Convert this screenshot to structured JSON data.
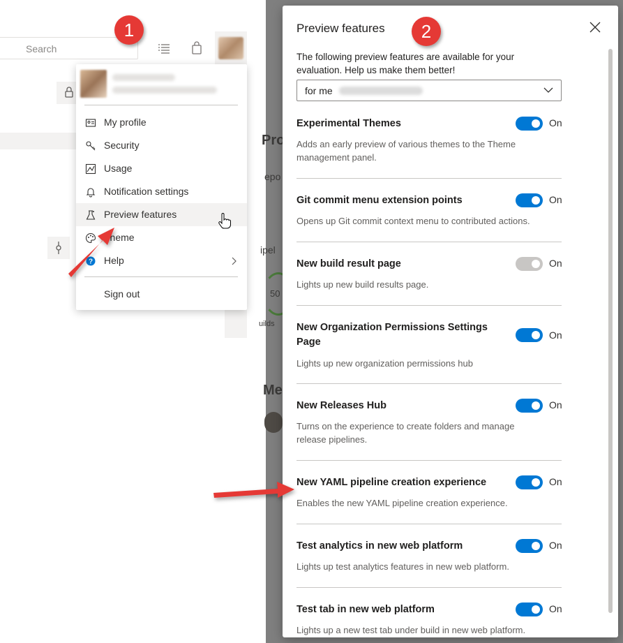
{
  "header": {
    "search_placeholder": "Search",
    "icons": [
      "search-icon",
      "list-icon",
      "shopping-bag-icon"
    ]
  },
  "profile_menu": {
    "items": [
      {
        "label": "My profile",
        "icon": "contact-card-icon"
      },
      {
        "label": "Security",
        "icon": "key-icon"
      },
      {
        "label": "Usage",
        "icon": "chart-icon"
      },
      {
        "label": "Notification settings",
        "icon": "bell-icon"
      },
      {
        "label": "Preview features",
        "icon": "flask-icon"
      },
      {
        "label": "Theme",
        "icon": "palette-icon"
      },
      {
        "label": "Help",
        "icon": "help-icon"
      }
    ],
    "sign_out": "Sign out"
  },
  "background": {
    "ghost_texts": [
      "Proj",
      "epo",
      "ipel",
      "50",
      "uilds",
      "Men"
    ]
  },
  "panel": {
    "title": "Preview features",
    "description": "The following preview features are available for your evaluation. Help us make them better!",
    "select_prefix": "for me",
    "features": [
      {
        "title": "Experimental Themes",
        "description": "Adds an early preview of various themes to the Theme management panel.",
        "state": "On",
        "enabled": true
      },
      {
        "title": "Git commit menu extension points",
        "description": "Opens up Git commit context menu to contributed actions.",
        "state": "On",
        "enabled": true
      },
      {
        "title": "New build result page",
        "description": "Lights up new build results page.",
        "state": "On",
        "enabled": false
      },
      {
        "title": "New Organization Permissions Settings Page",
        "description": "Lights up new organization permissions hub",
        "state": "On",
        "enabled": true
      },
      {
        "title": "New Releases Hub",
        "description": "Turns on the experience to create folders and manage release pipelines.",
        "state": "On",
        "enabled": true
      },
      {
        "title": "New YAML pipeline creation experience",
        "description": "Enables the new YAML pipeline creation experience.",
        "state": "On",
        "enabled": true
      },
      {
        "title": "Test analytics in new web platform",
        "description": "Lights up test analytics features in new web platform.",
        "state": "On",
        "enabled": true
      },
      {
        "title": "Test tab in new web platform",
        "description": "Lights up a new test tab under build in new web platform.",
        "state": "On",
        "enabled": true
      }
    ]
  },
  "annotations": {
    "badge_1": "1",
    "badge_2": "2",
    "color": "#e53935"
  },
  "colors": {
    "accent": "#0078d4",
    "toggle_disabled": "#c8c6c4",
    "overlay": "#7f7f7f"
  }
}
